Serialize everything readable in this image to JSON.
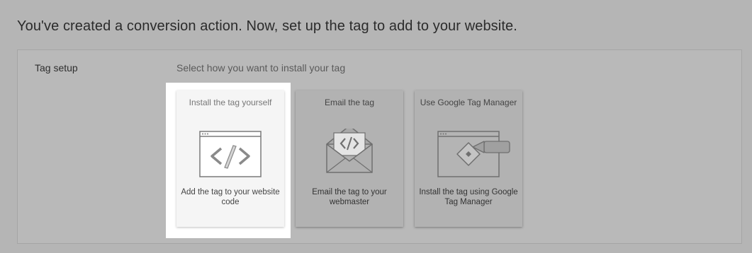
{
  "header": {
    "headline": "You've created a conversion action. Now, set up the tag to add to your website."
  },
  "panel": {
    "label": "Tag setup",
    "prompt": "Select how you want to install your tag"
  },
  "options": [
    {
      "title": "Install the tag yourself",
      "description": "Add the tag to your website code",
      "icon": "code-browser-icon",
      "selected": true
    },
    {
      "title": "Email the tag",
      "description": "Email the tag to your webmaster",
      "icon": "email-code-icon",
      "selected": false
    },
    {
      "title": "Use Google Tag Manager",
      "description": "Install the tag using Google Tag Manager",
      "icon": "tag-manager-icon",
      "selected": false
    }
  ],
  "colors": {
    "background": "#b5b5b5",
    "selected_card": "#f5f5f5",
    "icon_stroke": "#777777"
  }
}
